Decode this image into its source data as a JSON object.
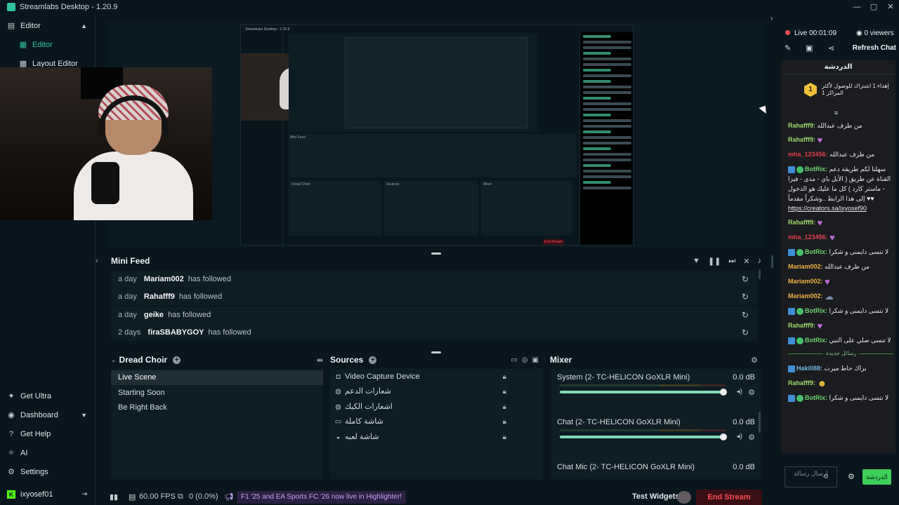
{
  "window": {
    "title": "Streamlabs Desktop - 1.20.9",
    "controls": [
      "—",
      "▢",
      "✕"
    ]
  },
  "sidebar": {
    "items": [
      {
        "label": "Editor",
        "icon": "editor-icon"
      },
      {
        "label": "Editor",
        "icon": "editor-icon"
      },
      {
        "label": "Layout Editor",
        "icon": "layout-editor-icon"
      }
    ],
    "bottom_items": [
      {
        "label": "Get Ultra",
        "icon": "ultra-icon"
      },
      {
        "label": "Dashboard",
        "icon": "dashboard-icon"
      },
      {
        "label": "Get Help",
        "icon": "help-icon"
      },
      {
        "label": "AI",
        "icon": "ai-icon"
      },
      {
        "label": "Settings",
        "icon": "gear-icon"
      },
      {
        "label": "ixyosef01",
        "icon": "kick-icon"
      }
    ]
  },
  "minifeed": {
    "title": "Mini Feed",
    "rows": [
      {
        "time": "a day",
        "user": "Mariam002",
        "action": "has followed"
      },
      {
        "time": "a day",
        "user": "Rahafff9",
        "action": "has followed"
      },
      {
        "time": "a day",
        "user": "geike",
        "action": "has followed"
      },
      {
        "time": "2 days",
        "user": "firaSBABYGOY",
        "action": "has followed"
      }
    ]
  },
  "scenes": {
    "title": "Dread Choir",
    "items": [
      "Live Scene",
      "Starting Soon",
      "Be Right Back"
    ]
  },
  "sources": {
    "title": "Sources",
    "items": [
      {
        "label": "Video Capture Device",
        "icon": "camera-icon"
      },
      {
        "label": "شعارات الدعم",
        "icon": "globe-icon"
      },
      {
        "label": "اشعارات الكيك",
        "icon": "globe-icon"
      },
      {
        "label": "شاشة كاملة",
        "icon": "monitor-icon"
      },
      {
        "label": "شاشة لعبه",
        "icon": "gamepad-icon"
      }
    ]
  },
  "mixer": {
    "title": "Mixer",
    "channels": [
      {
        "name": "System (2- TC-HELICON GoXLR Mini)",
        "db": "0.0 dB"
      },
      {
        "name": "Chat (2- TC-HELICON GoXLR Mini)",
        "db": "0.0 dB"
      },
      {
        "name": "Chat Mic (2- TC-HELICON GoXLR Mini)",
        "db": "0.0 dB"
      }
    ]
  },
  "footer": {
    "fps": "60.00 FPS",
    "dropped": "0 (0.0%)",
    "news": "F1 '25 and EA Sports FC '26 now live in Highlighter!",
    "test_widgets": "Test Widgets",
    "end_stream": "End Stream"
  },
  "chat": {
    "live_time": "Live 00:01:09",
    "viewers": "0 viewers",
    "refresh": "Refresh Chat",
    "header": "الدردشة",
    "pinned": {
      "badge": "1",
      "text": "إهداء 1 اشتراك للوصول لأكثر المراكز 1"
    },
    "messages": [
      {
        "user": "Rahafff9:",
        "text": "من طرف عبدالله",
        "color": "#9fd86a"
      },
      {
        "user": "Rahafff9:",
        "text": "",
        "emote": true,
        "color": "#9fd86a"
      },
      {
        "user": "mha_123456:",
        "text": "من طرف عبدالله",
        "color": "#e0414c"
      },
      {
        "user": "BotRix:",
        "text": "سهلنا لكم طريقة دعم القناة عن طريق ( الأبل باي - مدى - فيزا - ماستر كارد ) كل ما عليك هو الدخول إلى هذا الرابط ..وشكراً مقدماً ♥♥",
        "color": "#6fd26f",
        "bot": true
      },
      {
        "user": "",
        "text": "https://creators.sa/ixyosef90",
        "link": true
      },
      {
        "user": "Rahafff9:",
        "text": "",
        "emote": true,
        "color": "#9fd86a"
      },
      {
        "user": "mha_123456:",
        "text": "",
        "emote": true,
        "color": "#e0414c"
      },
      {
        "user": "BotRix:",
        "text": "لا تنسى دايمنى و شكرا",
        "color": "#6fd26f",
        "bot": true
      },
      {
        "user": "Mariam002:",
        "text": "من طرف عبدالله",
        "color": "#f0b040"
      },
      {
        "user": "Mariam002:",
        "text": "",
        "emote": true,
        "color": "#f0b040"
      },
      {
        "user": "Mariam002:",
        "text": "",
        "emote": true,
        "color": "#f0b040"
      },
      {
        "user": "BotRix:",
        "text": "لا تنسى دايمنى و شكرا",
        "color": "#6fd26f",
        "bot": true
      },
      {
        "user": "Rahafff9:",
        "text": "",
        "emote": true,
        "color": "#9fd86a"
      },
      {
        "user": "BotRix:",
        "text": "لا تنسى صلي على النبي",
        "color": "#6fd26f",
        "bot": true
      }
    ],
    "divider": "رسائل جديدة",
    "messages_after": [
      {
        "user": "Haki088:",
        "text": "براك حاط ميرت",
        "color": "#6fb8e0",
        "bot": true
      },
      {
        "user": "Rahafff9:",
        "text": "",
        "emote": true,
        "color": "#9fd86a"
      },
      {
        "user": "BotRix:",
        "text": "لا تنسى دايمنى و شكرا",
        "color": "#6fd26f",
        "bot": true
      }
    ],
    "input_placeholder": "إرسال رسالة",
    "send": "الدردشة"
  },
  "preview": {
    "inner_title": "Streamlabs Desktop - 1.20.9",
    "inner_minifeed": "Mini Feed",
    "inner_scenes": "Dread Choir",
    "inner_sources": "Sources",
    "inner_mixer": "Mixer",
    "inner_end": "End Stream"
  }
}
